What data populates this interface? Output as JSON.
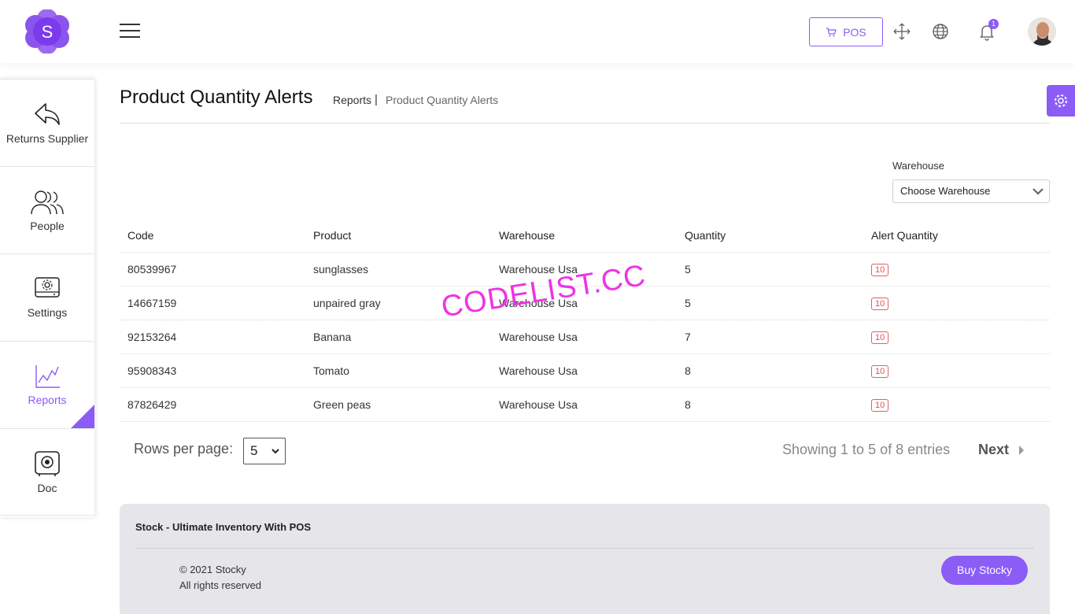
{
  "header": {
    "logo_letter": "S",
    "pos_label": "POS",
    "notification_count": "1"
  },
  "sidebar": {
    "items": [
      {
        "label": "Returns Supplier",
        "icon": "return-arrow-icon"
      },
      {
        "label": "People",
        "icon": "people-icon"
      },
      {
        "label": "Settings",
        "icon": "settings-icon"
      },
      {
        "label": "Reports",
        "icon": "chart-icon",
        "active": true
      },
      {
        "label": "Doc",
        "icon": "doc-icon"
      }
    ]
  },
  "page": {
    "title": "Product Quantity Alerts",
    "breadcrumb": [
      "Reports",
      "Product Quantity Alerts"
    ],
    "breadcrumb_sep": "|"
  },
  "filter": {
    "label": "Warehouse",
    "value": "Choose Warehouse"
  },
  "table": {
    "headers": [
      "Code",
      "Product",
      "Warehouse",
      "Quantity",
      "Alert Quantity"
    ],
    "rows": [
      {
        "code": "80539967",
        "product": "sunglasses",
        "warehouse": "Warehouse Usa",
        "quantity": "5",
        "alert": "10"
      },
      {
        "code": "14667159",
        "product": "unpaired gray",
        "warehouse": "Warehouse Usa",
        "quantity": "5",
        "alert": "10"
      },
      {
        "code": "92153264",
        "product": "Banana",
        "warehouse": "Warehouse Usa",
        "quantity": "7",
        "alert": "10"
      },
      {
        "code": "95908343",
        "product": "Tomato",
        "warehouse": "Warehouse Usa",
        "quantity": "8",
        "alert": "10"
      },
      {
        "code": "87826429",
        "product": "Green peas",
        "warehouse": "Warehouse Usa",
        "quantity": "8",
        "alert": "10"
      }
    ]
  },
  "pagination": {
    "rows_per_page_label": "Rows per page:",
    "rows_per_page_value": "5",
    "showing": "Showing 1 to 5 of 8 entries",
    "next_label": "Next"
  },
  "footer": {
    "title": "Stock - Ultimate Inventory With POS",
    "copyright": "© 2021 Stocky",
    "rights": "All rights reserved",
    "buy_label": "Buy Stocky"
  },
  "watermark": "CODELIST.CC",
  "colors": {
    "accent": "#8b5cf6",
    "alert": "#d9534f",
    "watermark": "#ee33e6"
  }
}
